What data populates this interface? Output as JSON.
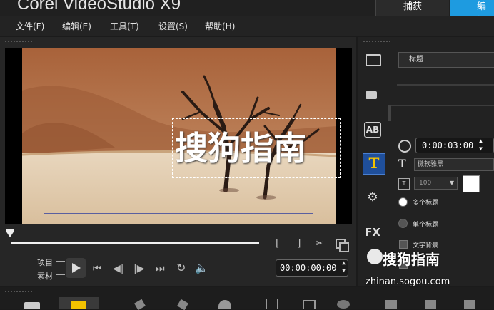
{
  "app": {
    "title": "Corel VideoStudio X9"
  },
  "top_tabs": [
    {
      "label": "捕获"
    },
    {
      "label": "编辑"
    }
  ],
  "menu": [
    {
      "label": "文件(F)"
    },
    {
      "label": "编辑(E)"
    },
    {
      "label": "工具(T)"
    },
    {
      "label": "设置(S)"
    },
    {
      "label": "帮助(H)"
    }
  ],
  "preview": {
    "overlay_text": "搜狗指南"
  },
  "playback": {
    "project_label": "项目",
    "clip_label": "素材",
    "timecode": "00:00:00:00",
    "scrub_position": 0
  },
  "options_panel": {
    "title_dropdown": "标题",
    "duration": "0:00:03:00",
    "font": "微软雅黑",
    "font_size": "100",
    "font_color": "#ffffff",
    "multi_title_label": "多个标题",
    "single_title_label": "单个标题",
    "text_background_label": "文字背景",
    "selected_mode": "多个标题"
  },
  "side_icons": [
    "media-icon",
    "instant-project-icon",
    "transition-icon",
    "title-icon",
    "graphic-icon",
    "filter-icon"
  ],
  "side_icon_text": {
    "transition": "AB",
    "filter": "FX",
    "title": "T"
  },
  "watermark": {
    "text": "搜狗指南",
    "url": "zhinan.sogou.com"
  },
  "colors": {
    "accent": "#1e9be0",
    "title_icon": "#f2c200"
  }
}
